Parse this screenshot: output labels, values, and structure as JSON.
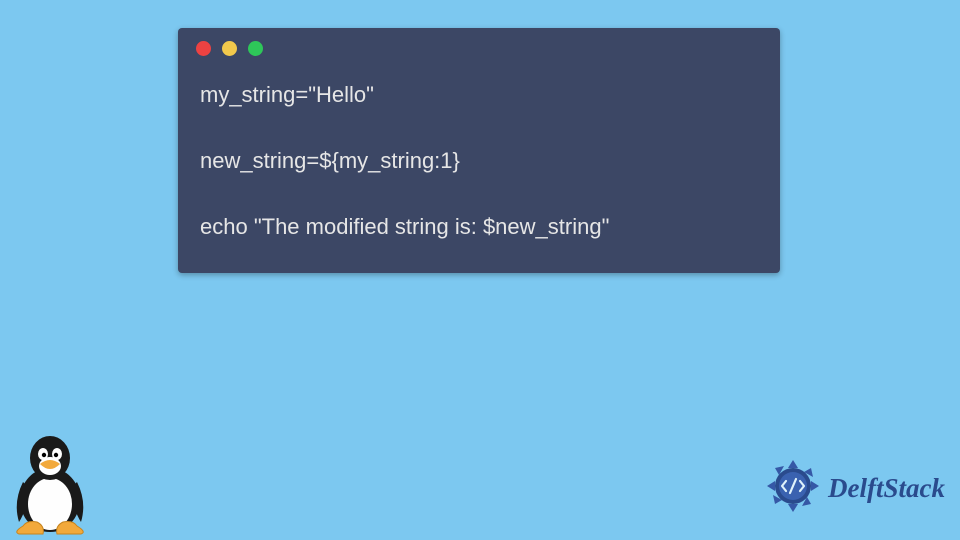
{
  "code": {
    "line1": "my_string=\"Hello\"",
    "line2": "new_string=${my_string:1}",
    "line3": "echo \"The modified string is: $new_string\""
  },
  "branding": {
    "name": "DelftStack"
  },
  "colors": {
    "background": "#7cc8f0",
    "codeWindow": "#3c4765",
    "codeText": "#e6e6e6",
    "dotRed": "#ed4242",
    "dotYellow": "#f2c94c",
    "dotGreen": "#2ec759",
    "brandBlue": "#2a4b8d"
  }
}
